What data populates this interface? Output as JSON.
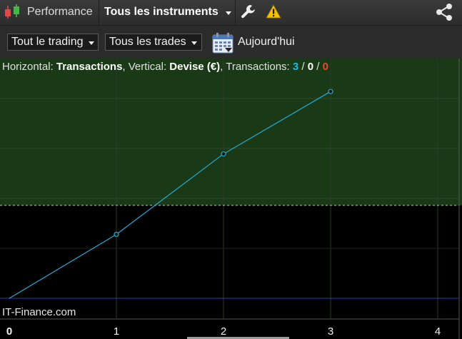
{
  "topbar": {
    "app_title": "Performance",
    "instrument_label": "Tous les instruments",
    "app_icon": "candlestick-chart-icon",
    "tools_icon": "wrench-icon",
    "warning_icon": "warning-triangle-icon",
    "share_icon": "share-icon"
  },
  "toolbar": {
    "trading_dropdown": "Tout le trading",
    "trades_dropdown": "Tous les trades",
    "calendar_icon": "calendar-icon",
    "date_label": "Aujourd'hui"
  },
  "chart_header": {
    "horizontal_prefix": "Horizontal: ",
    "horizontal_value": "Transactions",
    "vertical_prefix": ", Vertical: ",
    "vertical_value": "Devise (€)",
    "transactions_prefix": ", Transactions: ",
    "count_total": "3",
    "sep1": " / ",
    "count_neutral": "0",
    "sep2": " / ",
    "count_loss": "0"
  },
  "watermark": "IT-Finance.com",
  "colors": {
    "profit_zone": "#1a3a17",
    "loss_zone": "#000000",
    "line": "#28a9d6",
    "baseline": "#2a3db8",
    "threshold": "#b9c9a8"
  },
  "chart_data": {
    "type": "line",
    "xlabel": "",
    "ylabel": "",
    "x_ticks": [
      "0",
      "1",
      "2",
      "3",
      "4"
    ],
    "xlim": [
      0,
      4.2
    ],
    "ylim": [
      0,
      4.8
    ],
    "x": [
      0,
      1,
      2,
      3
    ],
    "y": [
      0,
      1.28,
      2.89,
      4.14
    ],
    "threshold_y": 1.86,
    "grid": true
  }
}
